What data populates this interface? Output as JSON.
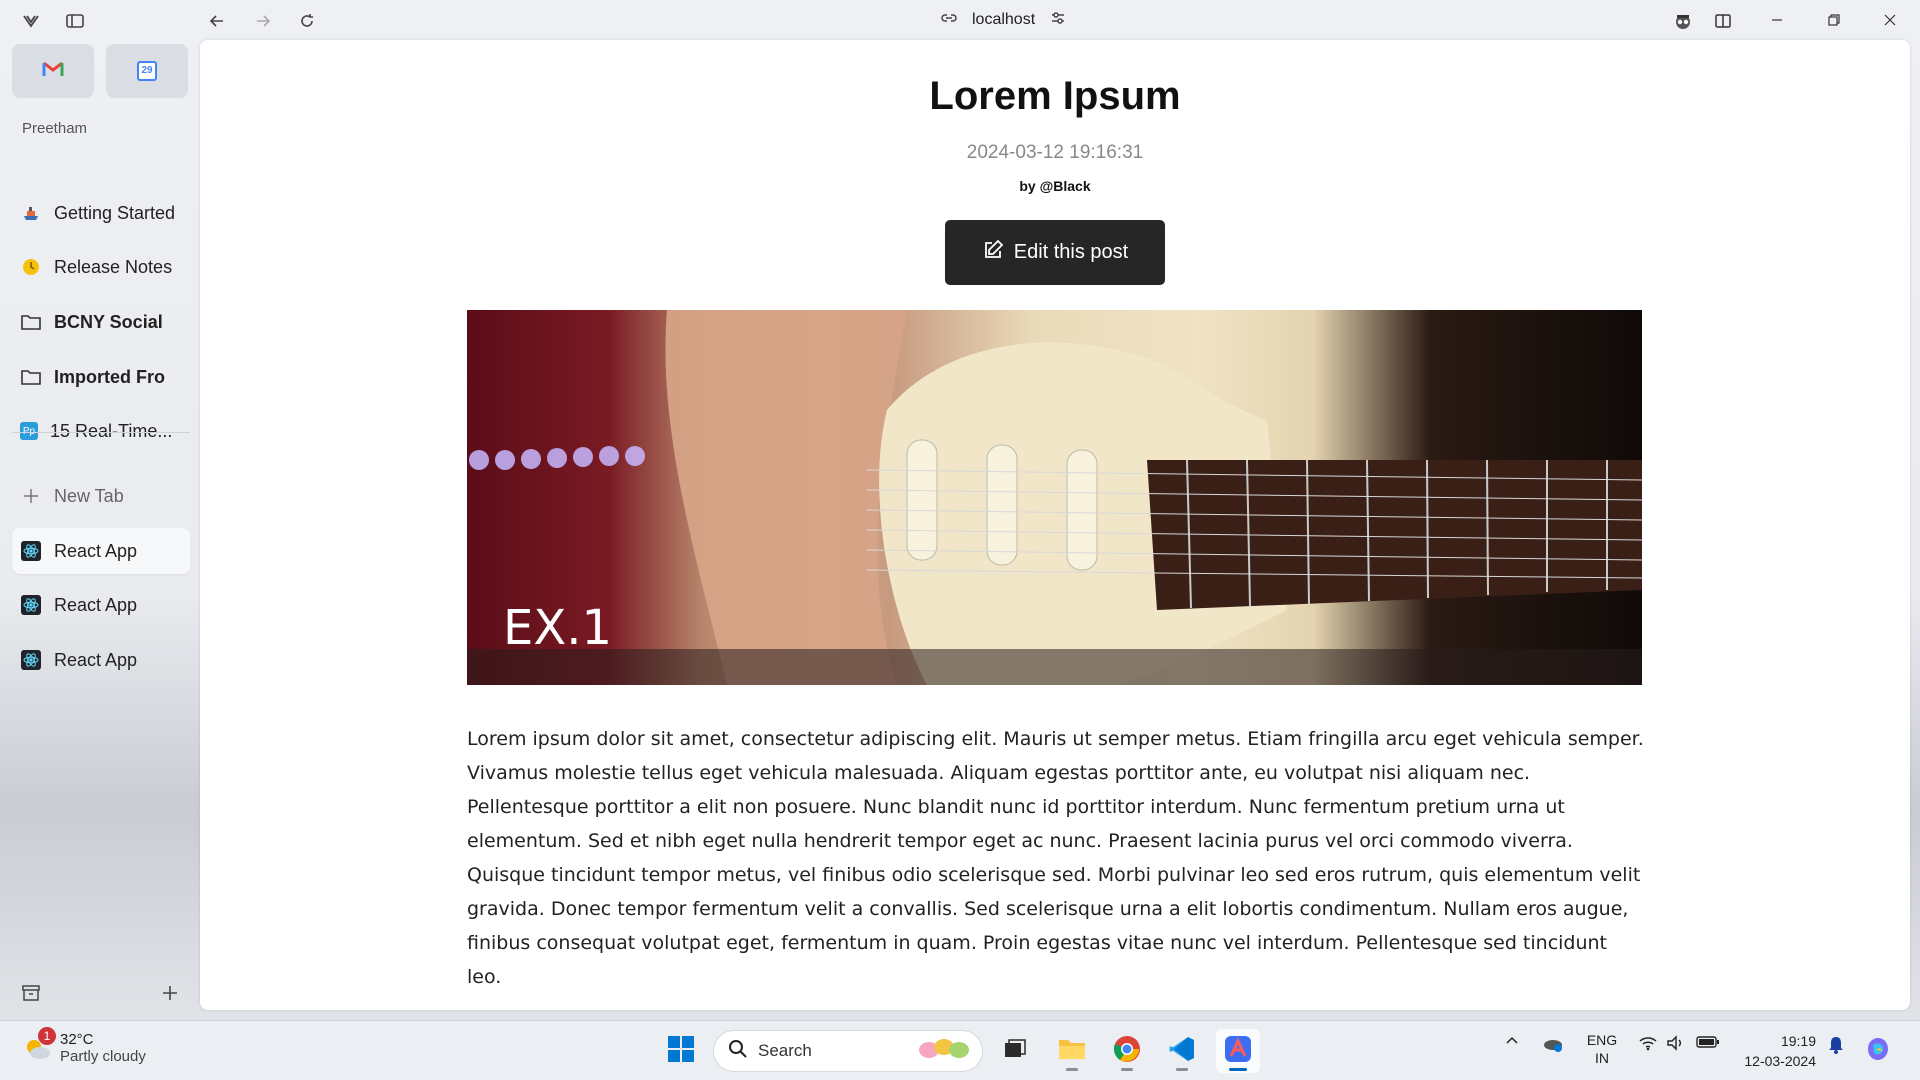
{
  "browser": {
    "address": "localhost"
  },
  "sidebar": {
    "profile": "Preetham",
    "favorites": [
      {
        "name": "Gmail",
        "icon": "gmail-icon"
      },
      {
        "name": "Calendar",
        "icon": "calendar-icon",
        "day": "29"
      }
    ],
    "pinned": [
      {
        "label": "Getting Started",
        "icon": "ship-icon"
      },
      {
        "label": "Release Notes",
        "icon": "clock-icon"
      },
      {
        "label": "BCNY Social",
        "icon": "folder-icon"
      },
      {
        "label": "Imported Fro",
        "icon": "folder-icon"
      },
      {
        "label": "15 Real-Time...",
        "icon": "pp-icon",
        "icon_text": "Pp"
      }
    ],
    "new_tab": "New Tab",
    "tabs": [
      {
        "label": "React App",
        "icon": "react-icon"
      },
      {
        "label": "React App",
        "icon": "react-icon"
      },
      {
        "label": "React App",
        "icon": "react-icon"
      }
    ]
  },
  "post": {
    "title": "Lorem Ipsum",
    "date": "2024-03-12 19:16:31",
    "author": "by @Black",
    "edit_label": "Edit this post",
    "image_label": "EX.1",
    "body": "Lorem ipsum dolor sit amet, consectetur adipiscing elit. Mauris ut semper metus. Etiam fringilla arcu eget vehicula semper. Vivamus molestie tellus eget vehicula malesuada. Aliquam egestas porttitor ante, eu volutpat nisi aliquam nec. Pellentesque porttitor a elit non posuere. Nunc blandit nunc id porttitor interdum. Nunc fermentum pretium urna ut elementum. Sed et nibh eget nulla hendrerit tempor eget ac nunc. Praesent lacinia purus vel orci commodo viverra. Quisque tincidunt tempor metus, vel finibus odio scelerisque sed. Morbi pulvinar leo sed eros rutrum, quis elementum velit gravida. Donec tempor fermentum velit a convallis. Sed scelerisque urna a elit lobortis condimentum. Nullam eros augue, finibus consequat volutpat eget, fermentum in quam. Proin egestas vitae nunc vel interdum. Pellentesque sed tincidunt leo."
  },
  "taskbar": {
    "weather_temp": "32°C",
    "weather_desc": "Partly cloudy",
    "weather_badge": "1",
    "search_placeholder": "Search",
    "language": "ENG",
    "region": "IN",
    "time": "19:19",
    "date": "12-03-2024"
  },
  "colors": {
    "button_bg": "#262626",
    "accent": "#0067c0"
  }
}
